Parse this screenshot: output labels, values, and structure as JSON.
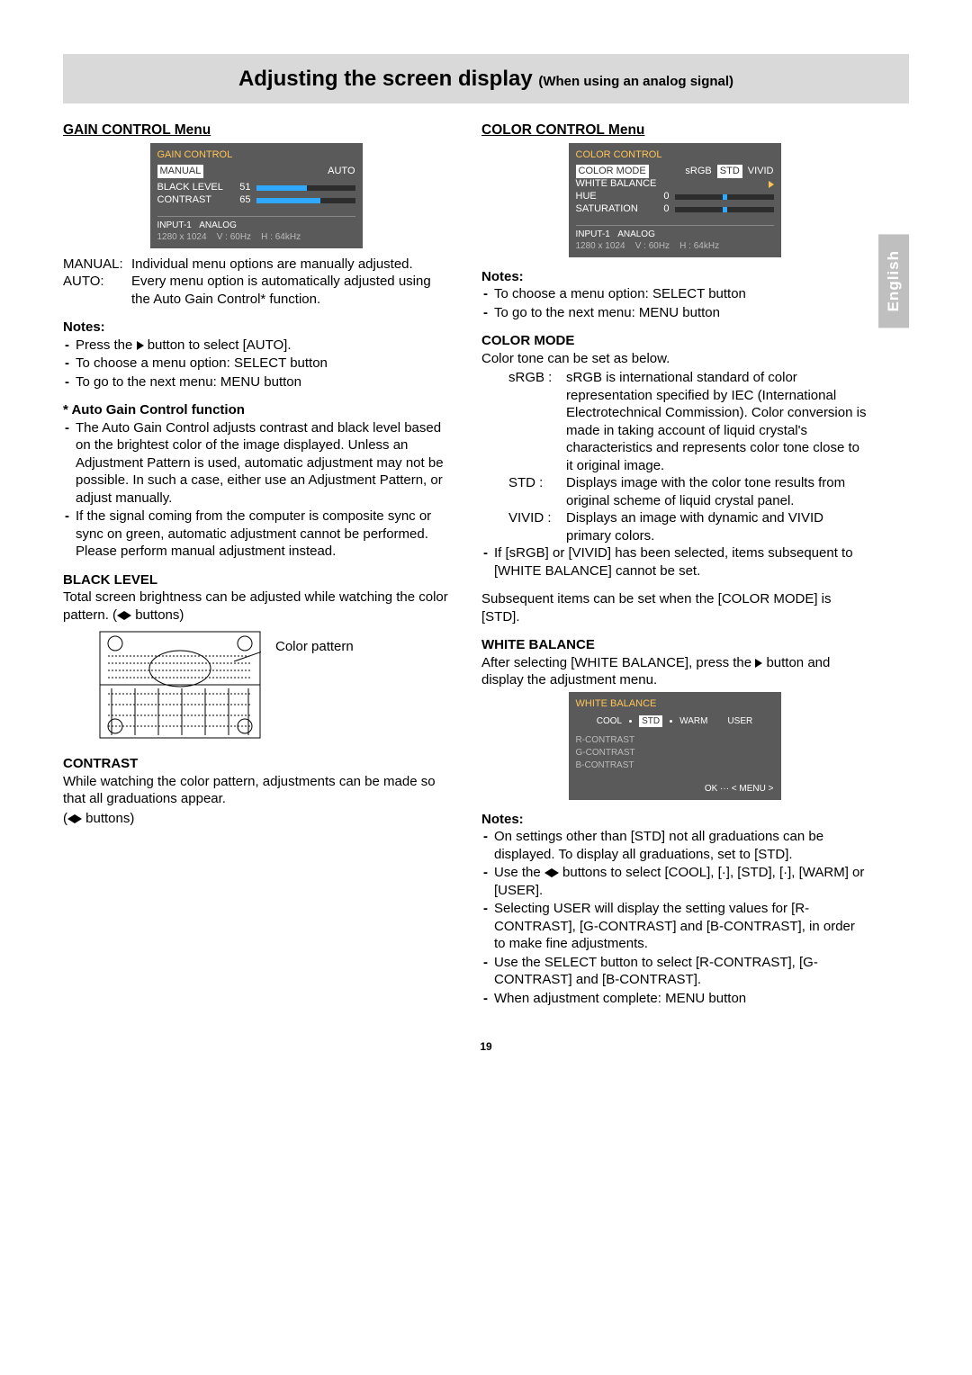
{
  "title": {
    "main": "Adjusting the screen display ",
    "sub": "(When using an analog signal)"
  },
  "lang_tab": "English",
  "page_number": "19",
  "left": {
    "heading": "GAIN CONTROL Menu",
    "osd": {
      "title": "GAIN CONTROL",
      "manual": "MANUAL",
      "auto": "AUTO",
      "rows": [
        {
          "label": "BLACK LEVEL",
          "value": "51"
        },
        {
          "label": "CONTRAST",
          "value": "65"
        }
      ],
      "foot1a": "INPUT-1",
      "foot1b": "ANALOG",
      "foot2a": "1280 x 1024",
      "foot2b": "V : 60Hz",
      "foot2c": "H : 64kHz"
    },
    "manual_def_k": "MANUAL:",
    "manual_def_v": "Individual menu options are manually adjusted.",
    "auto_def_k": "AUTO:",
    "auto_def_v": "Every menu option is automatically adjusted using the Auto Gain Control* function.",
    "notes_h": "Notes:",
    "notes": [
      "Press the ▶ button to select [AUTO].",
      "To choose a menu option: SELECT button",
      "To go to the next menu:    MENU button"
    ],
    "agc_h": "* Auto Gain Control function",
    "agc": [
      "The Auto Gain Control adjusts contrast and black level based on the brightest color of the image displayed. Unless an Adjustment Pattern is used, automatic adjustment may not be possible. In such a case, either use an Adjustment Pattern, or adjust manually.",
      "If the signal coming from the computer is composite sync or sync on green, automatic adjustment cannot be performed. Please perform manual adjustment instead."
    ],
    "black_h": "BLACK LEVEL",
    "black_p1": "Total screen brightness can be adjusted while watching the color pattern. (",
    "black_p2": " buttons)",
    "pattern_label": "Color pattern",
    "contrast_h": "CONTRAST",
    "contrast_p1": "While watching the color pattern, adjustments can be made so that all graduations appear.",
    "contrast_p2a": "(",
    "contrast_p2b": " buttons)"
  },
  "right": {
    "heading": "COLOR CONTROL Menu",
    "osd": {
      "title": "COLOR CONTROL",
      "row1_label": "COLOR MODE",
      "row1_opts": [
        "sRGB",
        "STD",
        "VIVID"
      ],
      "rows_rest": [
        {
          "label": "WHITE BALANCE"
        },
        {
          "label": "HUE",
          "value": "0"
        },
        {
          "label": "SATURATION",
          "value": "0"
        }
      ],
      "foot1a": "INPUT-1",
      "foot1b": "ANALOG",
      "foot2a": "1280 x 1024",
      "foot2b": "V : 60Hz",
      "foot2c": "H : 64kHz"
    },
    "notes_h": "Notes:",
    "notes": [
      "To choose a menu option: SELECT button",
      "To go to the next menu:    MENU button"
    ],
    "cm_h": "COLOR MODE",
    "cm_intro": "Color tone can be set as below.",
    "cm_defs": [
      {
        "k": "sRGB :",
        "v": "sRGB is international standard of color representation specified by IEC (International Electrotechnical Commission). Color conversion is made in taking account of liquid crystal's characteristics and represents color tone close to it original image."
      },
      {
        "k": "STD :",
        "v": "Displays image with the color tone results from original scheme of liquid crystal panel."
      },
      {
        "k": "VIVID :",
        "v": "Displays an image with dynamic and VIVID primary colors."
      }
    ],
    "cm_note": "If [sRGB] or [VIVID] has been selected, items subsequent to [WHITE BALANCE] cannot be set.",
    "subseq": "Subsequent items can be set when the [COLOR MODE] is [STD].",
    "wb_h": "WHITE BALANCE",
    "wb_p1": "After selecting [WHITE BALANCE], press the ",
    "wb_p2": " button and display the adjustment menu.",
    "wb_osd": {
      "title": "WHITE BALANCE",
      "scale": [
        "COOL",
        "STD",
        "WARM",
        "USER"
      ],
      "items": [
        "R-CONTRAST",
        "G-CONTRAST",
        "B-CONTRAST"
      ],
      "foot": "OK ··· < MENU >"
    },
    "wb_notes_h": "Notes:",
    "wb_notes_a": "On settings other than [STD] not all graduations can be displayed. To display all graduations, set to [STD].",
    "wb_notes_b1": "Use the ",
    "wb_notes_b2": " buttons to select [COOL], [·], [STD], [·], [WARM] or [USER].",
    "wb_notes_c": "Selecting USER will display the setting values for [R-CONTRAST], [G-CONTRAST] and [B-CONTRAST], in order to make fine adjustments.",
    "wb_notes_d": "Use the SELECT button to select [R-CONTRAST], [G-CONTRAST] and [B-CONTRAST].",
    "wb_notes_e": "When adjustment complete:  MENU button"
  }
}
